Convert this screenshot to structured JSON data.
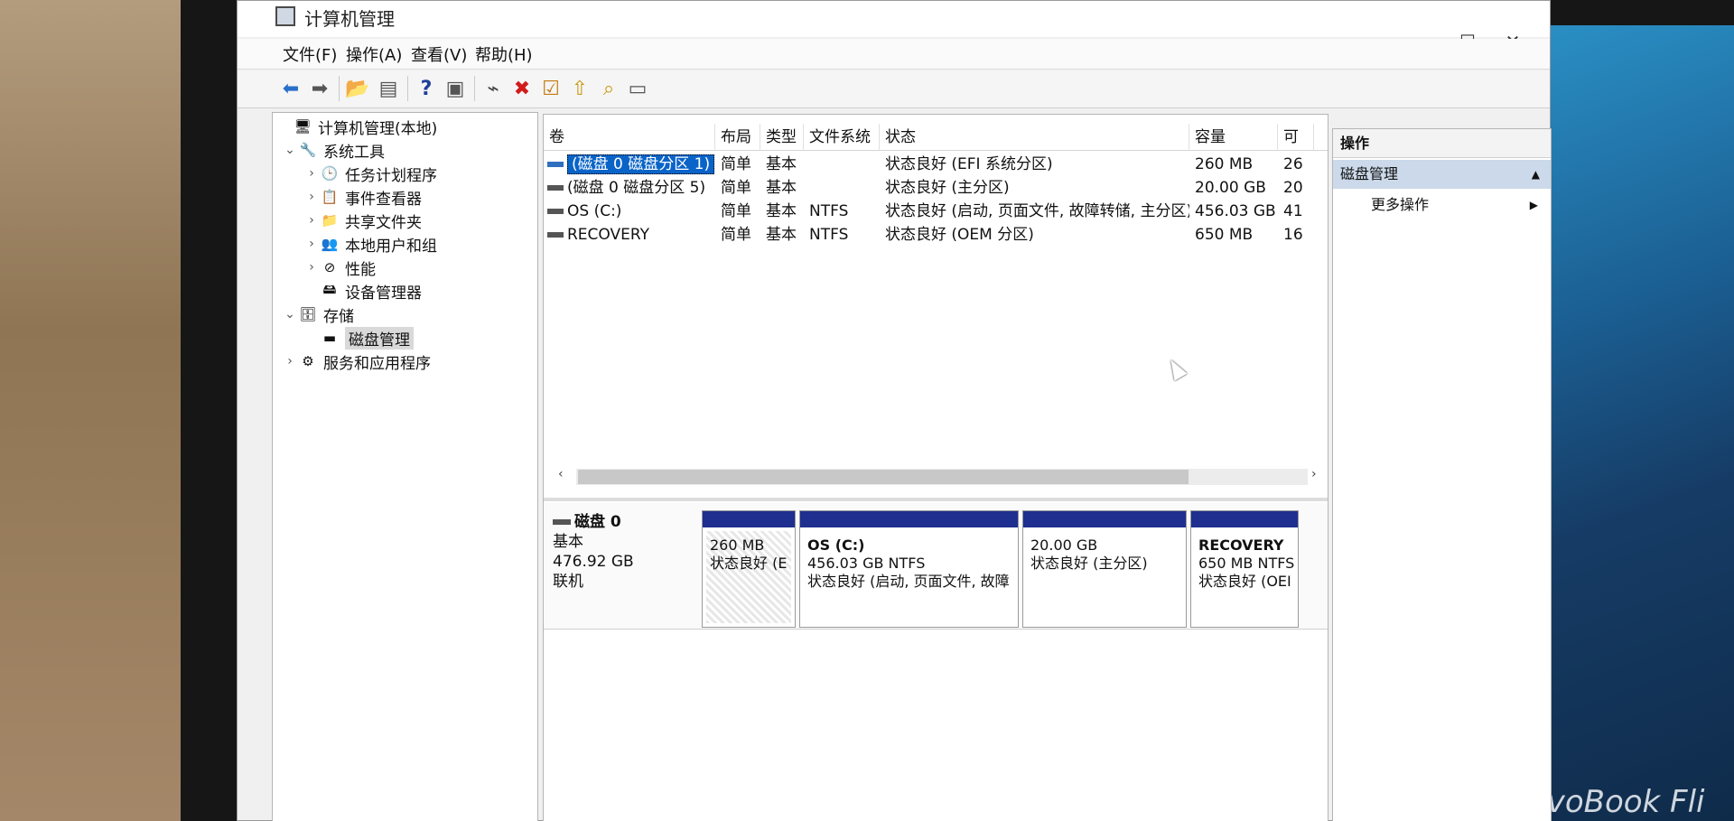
{
  "window": {
    "title": "计算机管理",
    "min": "—",
    "max": "☐",
    "close": "✕"
  },
  "menu": [
    "文件(F)",
    "操作(A)",
    "查看(V)",
    "帮助(H)"
  ],
  "tree": {
    "root": "计算机管理(本地)",
    "system_tools": "系统工具",
    "task_scheduler": "任务计划程序",
    "event_viewer": "事件查看器",
    "shared_folders": "共享文件夹",
    "local_users": "本地用户和组",
    "performance": "性能",
    "device_manager": "设备管理器",
    "storage": "存储",
    "disk_management": "磁盘管理",
    "services_apps": "服务和应用程序"
  },
  "volumes": {
    "columns": [
      "卷",
      "布局",
      "类型",
      "文件系统",
      "状态",
      "容量",
      "可"
    ],
    "rows": [
      {
        "name": "(磁盘 0 磁盘分区 1)",
        "layout": "简单",
        "type": "基本",
        "fs": "",
        "status": "状态良好 (EFI 系统分区)",
        "capacity": "260 MB",
        "free": "26"
      },
      {
        "name": "(磁盘 0 磁盘分区 5)",
        "layout": "简单",
        "type": "基本",
        "fs": "",
        "status": "状态良好 (主分区)",
        "capacity": "20.00 GB",
        "free": "20"
      },
      {
        "name": "OS (C:)",
        "layout": "简单",
        "type": "基本",
        "fs": "NTFS",
        "status": "状态良好 (启动, 页面文件, 故障转储, 主分区)",
        "capacity": "456.03 GB",
        "free": "41"
      },
      {
        "name": "RECOVERY",
        "layout": "简单",
        "type": "基本",
        "fs": "NTFS",
        "status": "状态良好 (OEM 分区)",
        "capacity": "650 MB",
        "free": "16"
      }
    ]
  },
  "disk": {
    "name": "磁盘 0",
    "kind": "基本",
    "size": "476.92 GB",
    "state": "联机",
    "partitions": [
      {
        "title": "",
        "size": "260 MB",
        "status": "状态良好 (E"
      },
      {
        "title": "OS  (C:)",
        "size": "456.03 GB NTFS",
        "status": "状态良好 (启动, 页面文件, 故障"
      },
      {
        "title": "",
        "size": "20.00 GB",
        "status": "状态良好 (主分区)"
      },
      {
        "title": "RECOVERY",
        "size": "650 MB NTFS",
        "status": "状态良好 (OEI"
      }
    ]
  },
  "actions": {
    "header": "操作",
    "section": "磁盘管理",
    "more": "更多操作"
  },
  "desktop": {
    "brand": "VivoBook Fli"
  },
  "colors": {
    "selection": "#0a64c8",
    "partition_bar": "#1e2f8f",
    "action_section": "#cbd9ea"
  }
}
